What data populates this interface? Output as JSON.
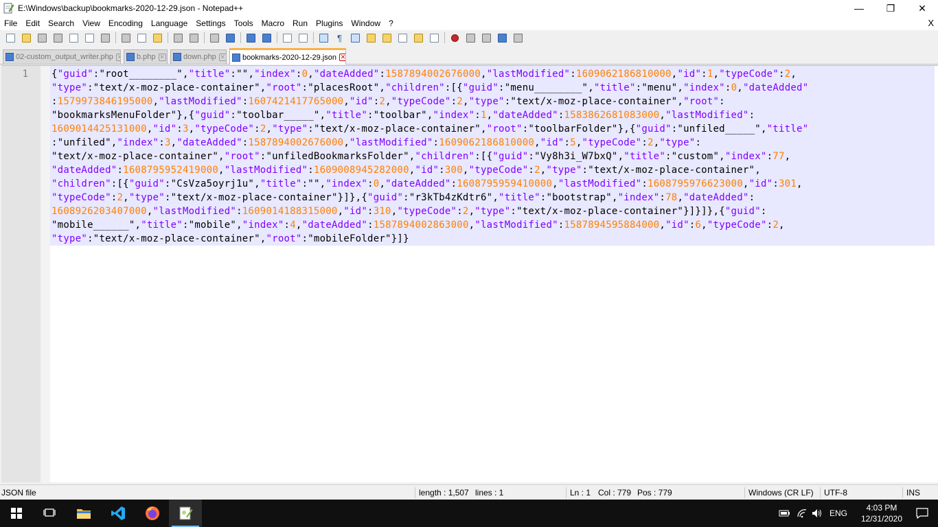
{
  "titlebar": {
    "title": "E:\\Windows\\backup\\bookmarks-2020-12-29.json - Notepad++",
    "minimize": "—",
    "restore": "❐",
    "close": "✕"
  },
  "menu": {
    "items": [
      "File",
      "Edit",
      "Search",
      "View",
      "Encoding",
      "Language",
      "Settings",
      "Tools",
      "Macro",
      "Run",
      "Plugins",
      "Window",
      "?"
    ],
    "close": "X"
  },
  "tabs": [
    {
      "label": "02-custom_output_writer.php",
      "active": false
    },
    {
      "label": "b.php",
      "active": false
    },
    {
      "label": "down.php",
      "active": false
    },
    {
      "label": "bookmarks-2020-12-29.json",
      "active": true
    }
  ],
  "tab_close_glyph": "✕",
  "editor": {
    "line_number": "1",
    "colors": {
      "keyword": "#8000ff",
      "string": "#000000",
      "number": "#ff8000",
      "selection": "#e8e8ff"
    },
    "lines": [
      [
        [
          "b",
          "{"
        ],
        [
          "k",
          "\"guid\""
        ],
        [
          "b",
          ":"
        ],
        [
          "s",
          "\"root________\""
        ],
        [
          "b",
          ","
        ],
        [
          "k",
          "\"title\""
        ],
        [
          "b",
          ":"
        ],
        [
          "s",
          "\"\""
        ],
        [
          "b",
          ","
        ],
        [
          "k",
          "\"index\""
        ],
        [
          "b",
          ":"
        ],
        [
          "n",
          "0"
        ],
        [
          "b",
          ","
        ],
        [
          "k",
          "\"dateAdded\""
        ],
        [
          "b",
          ":"
        ],
        [
          "n",
          "1587894002676000"
        ],
        [
          "b",
          ","
        ],
        [
          "k",
          "\"lastModified\""
        ],
        [
          "b",
          ":"
        ],
        [
          "n",
          "1609062186810000"
        ],
        [
          "b",
          ","
        ],
        [
          "k",
          "\"id\""
        ],
        [
          "b",
          ":"
        ],
        [
          "n",
          "1"
        ],
        [
          "b",
          ","
        ],
        [
          "k",
          "\"typeCode\""
        ],
        [
          "b",
          ":"
        ],
        [
          "n",
          "2"
        ],
        [
          "b",
          ","
        ]
      ],
      [
        [
          "k",
          "\"type\""
        ],
        [
          "b",
          ":"
        ],
        [
          "s",
          "\"text/x-moz-place-container\""
        ],
        [
          "b",
          ","
        ],
        [
          "k",
          "\"root\""
        ],
        [
          "b",
          ":"
        ],
        [
          "s",
          "\"placesRoot\""
        ],
        [
          "b",
          ","
        ],
        [
          "k",
          "\"children\""
        ],
        [
          "b",
          ":[{"
        ],
        [
          "k",
          "\"guid\""
        ],
        [
          "b",
          ":"
        ],
        [
          "s",
          "\"menu________\""
        ],
        [
          "b",
          ","
        ],
        [
          "k",
          "\"title\""
        ],
        [
          "b",
          ":"
        ],
        [
          "s",
          "\"menu\""
        ],
        [
          "b",
          ","
        ],
        [
          "k",
          "\"index\""
        ],
        [
          "b",
          ":"
        ],
        [
          "n",
          "0"
        ],
        [
          "b",
          ","
        ],
        [
          "k",
          "\"dateAdded\""
        ]
      ],
      [
        [
          "b",
          ":"
        ],
        [
          "n",
          "1579973846195000"
        ],
        [
          "b",
          ","
        ],
        [
          "k",
          "\"lastModified\""
        ],
        [
          "b",
          ":"
        ],
        [
          "n",
          "1607421417765000"
        ],
        [
          "b",
          ","
        ],
        [
          "k",
          "\"id\""
        ],
        [
          "b",
          ":"
        ],
        [
          "n",
          "2"
        ],
        [
          "b",
          ","
        ],
        [
          "k",
          "\"typeCode\""
        ],
        [
          "b",
          ":"
        ],
        [
          "n",
          "2"
        ],
        [
          "b",
          ","
        ],
        [
          "k",
          "\"type\""
        ],
        [
          "b",
          ":"
        ],
        [
          "s",
          "\"text/x-moz-place-container\""
        ],
        [
          "b",
          ","
        ],
        [
          "k",
          "\"root\""
        ],
        [
          "b",
          ":"
        ]
      ],
      [
        [
          "s",
          "\"bookmarksMenuFolder\""
        ],
        [
          "b",
          "},{"
        ],
        [
          "k",
          "\"guid\""
        ],
        [
          "b",
          ":"
        ],
        [
          "s",
          "\"toolbar_____\""
        ],
        [
          "b",
          ","
        ],
        [
          "k",
          "\"title\""
        ],
        [
          "b",
          ":"
        ],
        [
          "s",
          "\"toolbar\""
        ],
        [
          "b",
          ","
        ],
        [
          "k",
          "\"index\""
        ],
        [
          "b",
          ":"
        ],
        [
          "n",
          "1"
        ],
        [
          "b",
          ","
        ],
        [
          "k",
          "\"dateAdded\""
        ],
        [
          "b",
          ":"
        ],
        [
          "n",
          "1583862681083000"
        ],
        [
          "b",
          ","
        ],
        [
          "k",
          "\"lastModified\""
        ],
        [
          "b",
          ":"
        ]
      ],
      [
        [
          "n",
          "1609014425131000"
        ],
        [
          "b",
          ","
        ],
        [
          "k",
          "\"id\""
        ],
        [
          "b",
          ":"
        ],
        [
          "n",
          "3"
        ],
        [
          "b",
          ","
        ],
        [
          "k",
          "\"typeCode\""
        ],
        [
          "b",
          ":"
        ],
        [
          "n",
          "2"
        ],
        [
          "b",
          ","
        ],
        [
          "k",
          "\"type\""
        ],
        [
          "b",
          ":"
        ],
        [
          "s",
          "\"text/x-moz-place-container\""
        ],
        [
          "b",
          ","
        ],
        [
          "k",
          "\"root\""
        ],
        [
          "b",
          ":"
        ],
        [
          "s",
          "\"toolbarFolder\""
        ],
        [
          "b",
          "},{"
        ],
        [
          "k",
          "\"guid\""
        ],
        [
          "b",
          ":"
        ],
        [
          "s",
          "\"unfiled_____\""
        ],
        [
          "b",
          ","
        ],
        [
          "k",
          "\"title\""
        ]
      ],
      [
        [
          "b",
          ":"
        ],
        [
          "s",
          "\"unfiled\""
        ],
        [
          "b",
          ","
        ],
        [
          "k",
          "\"index\""
        ],
        [
          "b",
          ":"
        ],
        [
          "n",
          "3"
        ],
        [
          "b",
          ","
        ],
        [
          "k",
          "\"dateAdded\""
        ],
        [
          "b",
          ":"
        ],
        [
          "n",
          "1587894002676000"
        ],
        [
          "b",
          ","
        ],
        [
          "k",
          "\"lastModified\""
        ],
        [
          "b",
          ":"
        ],
        [
          "n",
          "1609062186810000"
        ],
        [
          "b",
          ","
        ],
        [
          "k",
          "\"id\""
        ],
        [
          "b",
          ":"
        ],
        [
          "n",
          "5"
        ],
        [
          "b",
          ","
        ],
        [
          "k",
          "\"typeCode\""
        ],
        [
          "b",
          ":"
        ],
        [
          "n",
          "2"
        ],
        [
          "b",
          ","
        ],
        [
          "k",
          "\"type\""
        ],
        [
          "b",
          ":"
        ]
      ],
      [
        [
          "s",
          "\"text/x-moz-place-container\""
        ],
        [
          "b",
          ","
        ],
        [
          "k",
          "\"root\""
        ],
        [
          "b",
          ":"
        ],
        [
          "s",
          "\"unfiledBookmarksFolder\""
        ],
        [
          "b",
          ","
        ],
        [
          "k",
          "\"children\""
        ],
        [
          "b",
          ":[{"
        ],
        [
          "k",
          "\"guid\""
        ],
        [
          "b",
          ":"
        ],
        [
          "s",
          "\"Vy8h3i_W7bxQ\""
        ],
        [
          "b",
          ","
        ],
        [
          "k",
          "\"title\""
        ],
        [
          "b",
          ":"
        ],
        [
          "s",
          "\"custom\""
        ],
        [
          "b",
          ","
        ],
        [
          "k",
          "\"index\""
        ],
        [
          "b",
          ":"
        ],
        [
          "n",
          "77"
        ],
        [
          "b",
          ","
        ]
      ],
      [
        [
          "k",
          "\"dateAdded\""
        ],
        [
          "b",
          ":"
        ],
        [
          "n",
          "1608795952419000"
        ],
        [
          "b",
          ","
        ],
        [
          "k",
          "\"lastModified\""
        ],
        [
          "b",
          ":"
        ],
        [
          "n",
          "1609008945282000"
        ],
        [
          "b",
          ","
        ],
        [
          "k",
          "\"id\""
        ],
        [
          "b",
          ":"
        ],
        [
          "n",
          "300"
        ],
        [
          "b",
          ","
        ],
        [
          "k",
          "\"typeCode\""
        ],
        [
          "b",
          ":"
        ],
        [
          "n",
          "2"
        ],
        [
          "b",
          ","
        ],
        [
          "k",
          "\"type\""
        ],
        [
          "b",
          ":"
        ],
        [
          "s",
          "\"text/x-moz-place-container\""
        ],
        [
          "b",
          ","
        ]
      ],
      [
        [
          "k",
          "\"children\""
        ],
        [
          "b",
          ":[{"
        ],
        [
          "k",
          "\"guid\""
        ],
        [
          "b",
          ":"
        ],
        [
          "s",
          "\"CsVza5oyrj1u\""
        ],
        [
          "b",
          ","
        ],
        [
          "k",
          "\"title\""
        ],
        [
          "b",
          ":"
        ],
        [
          "s",
          "\"\""
        ],
        [
          "b",
          ","
        ],
        [
          "k",
          "\"index\""
        ],
        [
          "b",
          ":"
        ],
        [
          "n",
          "0"
        ],
        [
          "b",
          ","
        ],
        [
          "k",
          "\"dateAdded\""
        ],
        [
          "b",
          ":"
        ],
        [
          "n",
          "1608795959410000"
        ],
        [
          "b",
          ","
        ],
        [
          "k",
          "\"lastModified\""
        ],
        [
          "b",
          ":"
        ],
        [
          "n",
          "1608795976623000"
        ],
        [
          "b",
          ","
        ],
        [
          "k",
          "\"id\""
        ],
        [
          "b",
          ":"
        ],
        [
          "n",
          "301"
        ],
        [
          "b",
          ","
        ]
      ],
      [
        [
          "k",
          "\"typeCode\""
        ],
        [
          "b",
          ":"
        ],
        [
          "n",
          "2"
        ],
        [
          "b",
          ","
        ],
        [
          "k",
          "\"type\""
        ],
        [
          "b",
          ":"
        ],
        [
          "s",
          "\"text/x-moz-place-container\""
        ],
        [
          "b",
          "}]},{"
        ],
        [
          "k",
          "\"guid\""
        ],
        [
          "b",
          ":"
        ],
        [
          "s",
          "\"r3kTb4zKdtr6\""
        ],
        [
          "b",
          ","
        ],
        [
          "k",
          "\"title\""
        ],
        [
          "b",
          ":"
        ],
        [
          "s",
          "\"bootstrap\""
        ],
        [
          "b",
          ","
        ],
        [
          "k",
          "\"index\""
        ],
        [
          "b",
          ":"
        ],
        [
          "n",
          "78"
        ],
        [
          "b",
          ","
        ],
        [
          "k",
          "\"dateAdded\""
        ],
        [
          "b",
          ":"
        ]
      ],
      [
        [
          "n",
          "1608926203407000"
        ],
        [
          "b",
          ","
        ],
        [
          "k",
          "\"lastModified\""
        ],
        [
          "b",
          ":"
        ],
        [
          "n",
          "1609014188315000"
        ],
        [
          "b",
          ","
        ],
        [
          "k",
          "\"id\""
        ],
        [
          "b",
          ":"
        ],
        [
          "n",
          "310"
        ],
        [
          "b",
          ","
        ],
        [
          "k",
          "\"typeCode\""
        ],
        [
          "b",
          ":"
        ],
        [
          "n",
          "2"
        ],
        [
          "b",
          ","
        ],
        [
          "k",
          "\"type\""
        ],
        [
          "b",
          ":"
        ],
        [
          "s",
          "\"text/x-moz-place-container\""
        ],
        [
          "b",
          "}]}]},{"
        ],
        [
          "k",
          "\"guid\""
        ],
        [
          "b",
          ":"
        ]
      ],
      [
        [
          "s",
          "\"mobile______\""
        ],
        [
          "b",
          ","
        ],
        [
          "k",
          "\"title\""
        ],
        [
          "b",
          ":"
        ],
        [
          "s",
          "\"mobile\""
        ],
        [
          "b",
          ","
        ],
        [
          "k",
          "\"index\""
        ],
        [
          "b",
          ":"
        ],
        [
          "n",
          "4"
        ],
        [
          "b",
          ","
        ],
        [
          "k",
          "\"dateAdded\""
        ],
        [
          "b",
          ":"
        ],
        [
          "n",
          "1587894002863000"
        ],
        [
          "b",
          ","
        ],
        [
          "k",
          "\"lastModified\""
        ],
        [
          "b",
          ":"
        ],
        [
          "n",
          "1587894595884000"
        ],
        [
          "b",
          ","
        ],
        [
          "k",
          "\"id\""
        ],
        [
          "b",
          ":"
        ],
        [
          "n",
          "6"
        ],
        [
          "b",
          ","
        ],
        [
          "k",
          "\"typeCode\""
        ],
        [
          "b",
          ":"
        ],
        [
          "n",
          "2"
        ],
        [
          "b",
          ","
        ]
      ],
      [
        [
          "k",
          "\"type\""
        ],
        [
          "b",
          ":"
        ],
        [
          "s",
          "\"text/x-moz-place-container\""
        ],
        [
          "b",
          ","
        ],
        [
          "k",
          "\"root\""
        ],
        [
          "b",
          ":"
        ],
        [
          "s",
          "\"mobileFolder\""
        ],
        [
          "b",
          "}]}"
        ]
      ]
    ]
  },
  "statusbar": {
    "file_type": "JSON file",
    "length": "length : 1,507",
    "lines": "lines : 1",
    "ln": "Ln : 1",
    "col": "Col : 779",
    "pos": "Pos : 779",
    "eol": "Windows (CR LF)",
    "encoding": "UTF-8",
    "mode": "INS"
  },
  "taskbar": {
    "language": "ENG",
    "time": "4:03 PM",
    "date": "12/31/2020"
  }
}
